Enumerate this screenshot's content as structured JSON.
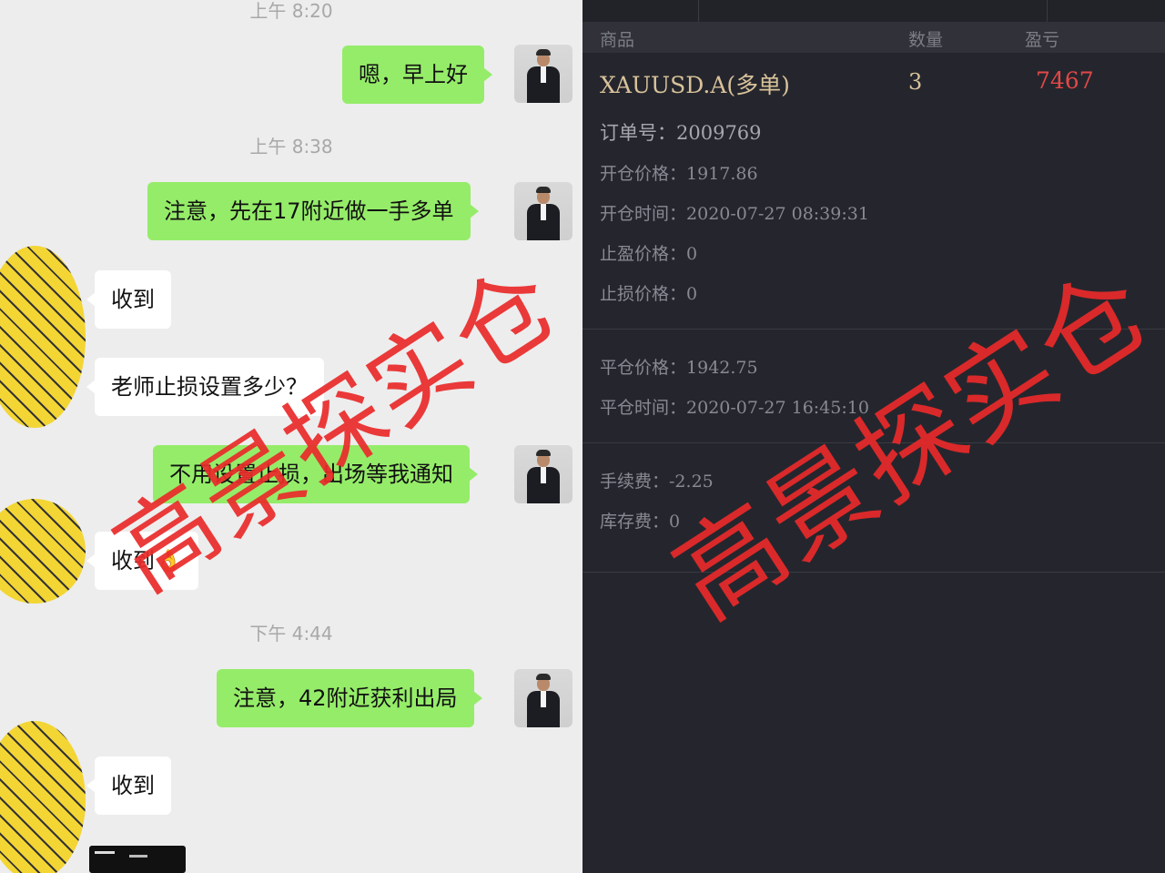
{
  "chat": {
    "timestamps": [
      "上午 8:20",
      "上午 8:38",
      "下午 4:44"
    ],
    "messages": [
      {
        "side": "out",
        "text": "嗯，早上好"
      },
      {
        "side": "out",
        "text": "注意，先在17附近做一手多单"
      },
      {
        "side": "in",
        "text": "收到"
      },
      {
        "side": "in",
        "text": "老师止损设置多少？"
      },
      {
        "side": "out",
        "text": "不用设置止损，出场等我通知"
      },
      {
        "side": "in",
        "text": "收到👌"
      },
      {
        "side": "out",
        "text": "注意，42附近获利出局"
      },
      {
        "side": "in",
        "text": "收到"
      }
    ]
  },
  "trade": {
    "headers": {
      "product": "商品",
      "quantity": "数量",
      "pnl": "盈亏"
    },
    "symbol": "XAUUSD.A(多单)",
    "quantity": "3",
    "pnl": "7467",
    "order_label": "订单号：",
    "order_no": "2009769",
    "open_price_label": "开仓价格：",
    "open_price": "1917.86",
    "open_time_label": "开仓时间：",
    "open_time": "2020-07-27 08:39:31",
    "tp_label": "止盈价格：",
    "tp": "0",
    "sl_label": "止损价格：",
    "sl": "0",
    "close_price_label": "平仓价格：",
    "close_price": "1942.75",
    "close_time_label": "平仓时间：",
    "close_time": "2020-07-27 16:45:10",
    "fee_label": "手续费：",
    "fee": "-2.25",
    "swap_label": "库存费：",
    "swap": "0"
  },
  "watermark": "高景探实仓",
  "colors": {
    "out_bubble": "#95ec69",
    "in_bubble": "#ffffff",
    "pnl": "#e24848",
    "symbol": "#d8c29a",
    "watermark": "#ea2a2a",
    "panel_bg": "#25262d"
  }
}
